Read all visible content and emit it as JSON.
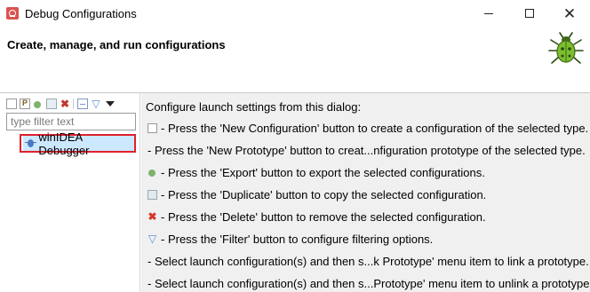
{
  "window": {
    "title": "Debug Configurations"
  },
  "header": {
    "title": "Create, manage, and run configurations"
  },
  "sidebar": {
    "filter_placeholder": "type filter text",
    "tree_items": [
      {
        "label": "winIDEA Debugger"
      }
    ],
    "toolbar_icons": [
      "new-configuration-icon",
      "new-prototype-icon",
      "export-icon",
      "duplicate-icon",
      "delete-icon",
      "collapse-all-icon",
      "filter-icon",
      "view-menu-icon"
    ]
  },
  "main": {
    "intro": "Configure launch settings from this dialog:",
    "lines": [
      {
        "icon": "new-configuration-icon",
        "text": "- Press the 'New Configuration' button to create a configuration of the selected type."
      },
      {
        "icon": "",
        "text": "- Press the 'New Prototype' button to creat...nfiguration prototype of the selected type."
      },
      {
        "icon": "export-icon",
        "text": "- Press the 'Export' button to export the selected configurations."
      },
      {
        "icon": "duplicate-icon",
        "text": "- Press the 'Duplicate' button to copy the selected configuration."
      },
      {
        "icon": "delete-icon",
        "text": "- Press the 'Delete' button to remove the selected configuration."
      },
      {
        "icon": "filter-icon",
        "text": "- Press the 'Filter' button to configure filtering options."
      },
      {
        "icon": "",
        "text": "- Select launch configuration(s) and then s...k Prototype' menu item to link a prototype."
      },
      {
        "icon": "",
        "text": "- Select launch configuration(s) and then s...Prototype' menu item to unlink a prototype."
      }
    ]
  },
  "colors": {
    "selection": "#cce8ff",
    "highlight_border": "#e0202c",
    "panel_bg": "#f0f0f0"
  }
}
